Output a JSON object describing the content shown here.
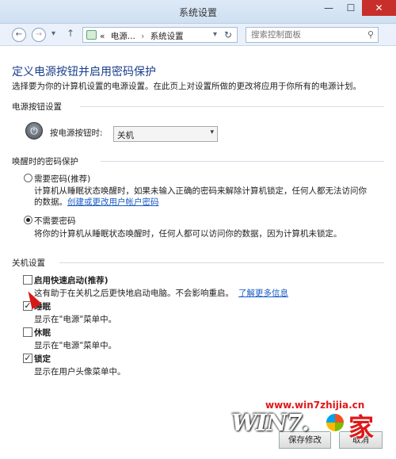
{
  "window": {
    "title": "系统设置",
    "min_glyph": "—",
    "max_glyph": "☐",
    "close_glyph": "✕"
  },
  "nav": {
    "back_glyph": "←",
    "forward_glyph": "→",
    "dropdown_glyph": "▾",
    "up_glyph": "↑",
    "breadcrumbs": [
      "«",
      "电源...",
      "系统设置"
    ],
    "refresh_glyph": "↻",
    "search_placeholder": "搜索控制面板",
    "search_glyph": "⚲"
  },
  "page": {
    "heading": "定义电源按钮并启用密码保护",
    "description": "选择要为你的计算机设置的电源设置。在此页上对设置所做的更改将应用于你所有的电源计划。"
  },
  "power_buttons": {
    "section_title": "电源按钮设置",
    "power_glyph": "⏻",
    "label": "按电源按钮时:",
    "selected": "关机",
    "chevron": "▾"
  },
  "wake_password": {
    "section_title": "唤醒时的密码保护",
    "options": [
      {
        "label": "需要密码(推荐)",
        "selected": false,
        "desc_line1": "计算机从睡眠状态唤醒时，如果未输入正确的密码来解除计算机锁定，任何人都无法访问你",
        "desc_line2": "的数据。",
        "link": "创建或更改用户帐户密码"
      },
      {
        "label": "不需要密码",
        "selected": true,
        "desc_line1": "将你的计算机从睡眠状态唤醒时，任何人都可以访问你的数据，因为计算机未锁定。"
      }
    ]
  },
  "shutdown": {
    "section_title": "关机设置",
    "items": [
      {
        "label": "启用快速启动(推荐)",
        "checked": false,
        "desc": "这有助于在关机之后更快地启动电脑。不会影响重启。",
        "link": "了解更多信息"
      },
      {
        "label": "睡眠",
        "checked": true,
        "desc": "显示在\"电源\"菜单中。"
      },
      {
        "label": "休眠",
        "checked": false,
        "desc": "显示在\"电源\"菜单中。"
      },
      {
        "label": "锁定",
        "checked": true,
        "desc": "显示在用户头像菜单中。"
      }
    ]
  },
  "footer": {
    "save_label": "保存修改",
    "cancel_label": "取消"
  },
  "watermark": {
    "url": "www.win7zhijia.cn",
    "logo_text": "WIN7.",
    "logo_char": "家"
  },
  "colors": {
    "heading": "#1a3e8a",
    "link": "#1a5bc4",
    "close_button": "#c7302a",
    "watermark_red": "#e01818"
  }
}
